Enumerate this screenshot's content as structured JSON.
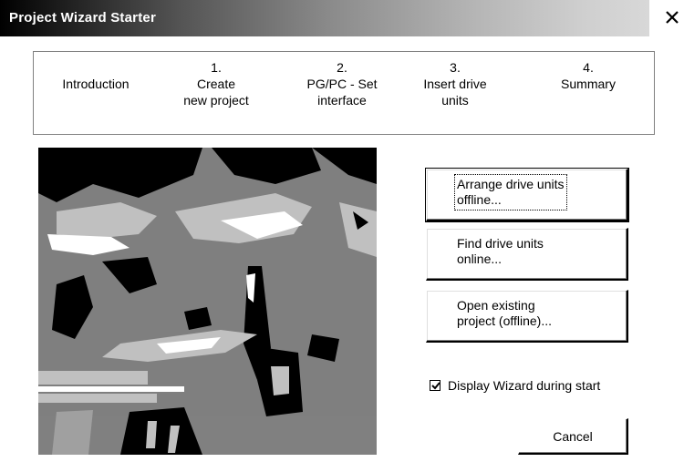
{
  "window": {
    "title": "Project Wizard Starter",
    "close_icon": "close-icon"
  },
  "steps": [
    {
      "number": "",
      "label": "Introduction"
    },
    {
      "number": "1.",
      "label": "Create\nnew project"
    },
    {
      "number": "2.",
      "label": "PG/PC - Set\ninterface"
    },
    {
      "number": "3.",
      "label": "Insert drive\nunits"
    },
    {
      "number": "4.",
      "label": "Summary"
    }
  ],
  "actions": {
    "arrange_offline": "Arrange drive units\noffline...",
    "find_online": "Find drive units\nonline...",
    "open_existing": "Open existing\nproject (offline)..."
  },
  "options": {
    "display_wizard_label": "Display Wizard during start",
    "display_wizard_checked": true
  },
  "buttons": {
    "cancel": "Cancel"
  },
  "colors": {
    "title_gradient_start": "#000000",
    "title_gradient_end": "#d8d8d8",
    "picture_dark": "#000000",
    "picture_mid": "#7f7f7f",
    "picture_light": "#c0c0c0"
  }
}
